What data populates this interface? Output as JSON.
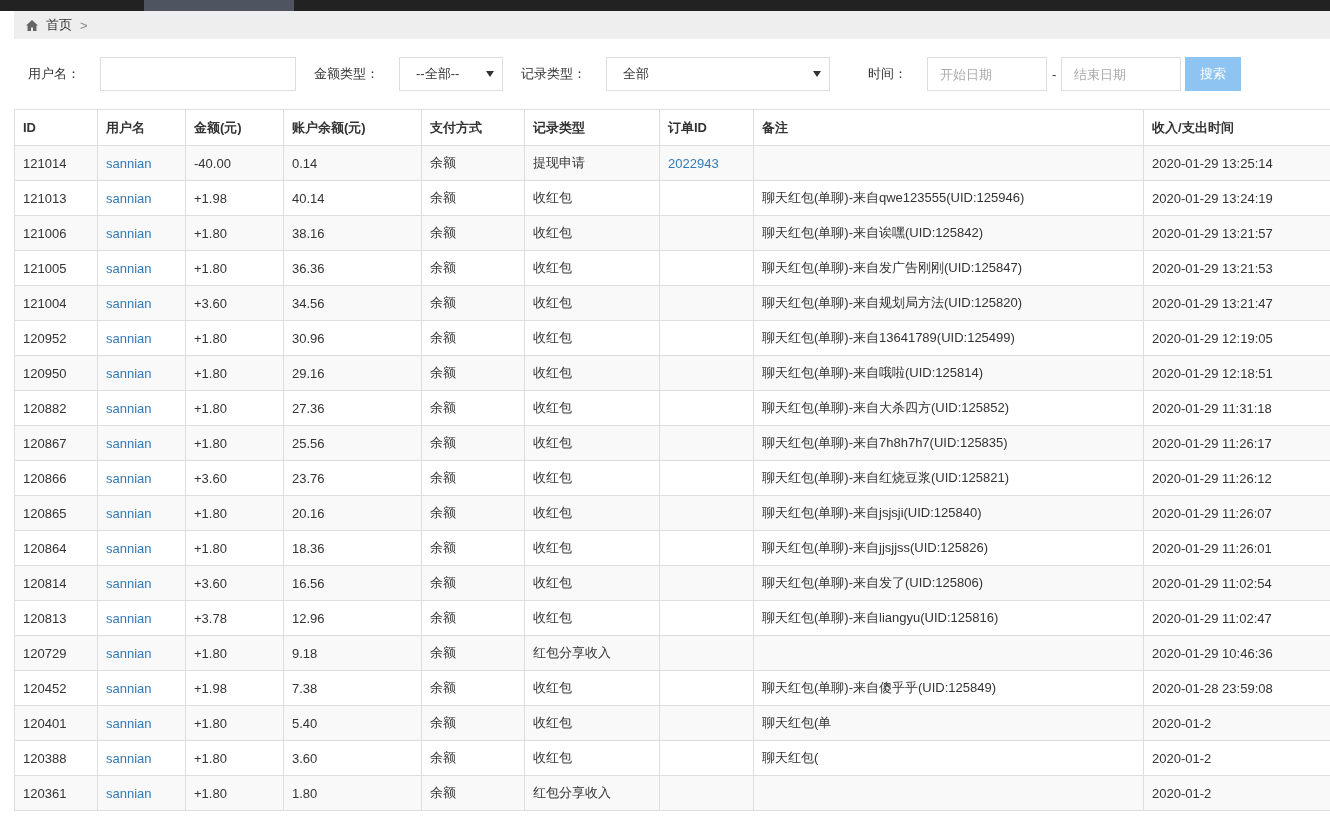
{
  "breadcrumb": {
    "home": "首页",
    "separator": ">"
  },
  "filters": {
    "username_label": "用户名：",
    "amount_type_label": "金额类型：",
    "amount_type_value": "--全部--",
    "record_type_label": "记录类型：",
    "record_type_value": "全部",
    "time_label": "时间：",
    "start_placeholder": "开始日期",
    "range_separator": "-",
    "end_placeholder": "结束日期",
    "search_button": "搜索"
  },
  "table": {
    "columns": [
      "ID",
      "用户名",
      "金额(元)",
      "账户余额(元)",
      "支付方式",
      "记录类型",
      "订单ID",
      "备注",
      "收入/支出时间"
    ],
    "rows": [
      [
        "121014",
        "sannian",
        "-40.00",
        "0.14",
        "余额",
        "提现申请",
        "2022943",
        "",
        "2020-01-29 13:25:14"
      ],
      [
        "121013",
        "sannian",
        "+1.98",
        "40.14",
        "余额",
        "收红包",
        "",
        "聊天红包(单聊)-来自qwe123555(UID:125946)",
        "2020-01-29 13:24:19"
      ],
      [
        "121006",
        "sannian",
        "+1.80",
        "38.16",
        "余额",
        "收红包",
        "",
        "聊天红包(单聊)-来自诶嘿(UID:125842)",
        "2020-01-29 13:21:57"
      ],
      [
        "121005",
        "sannian",
        "+1.80",
        "36.36",
        "余额",
        "收红包",
        "",
        "聊天红包(单聊)-来自发广告刚刚(UID:125847)",
        "2020-01-29 13:21:53"
      ],
      [
        "121004",
        "sannian",
        "+3.60",
        "34.56",
        "余额",
        "收红包",
        "",
        "聊天红包(单聊)-来自规划局方法(UID:125820)",
        "2020-01-29 13:21:47"
      ],
      [
        "120952",
        "sannian",
        "+1.80",
        "30.96",
        "余额",
        "收红包",
        "",
        "聊天红包(单聊)-来自13641789(UID:125499)",
        "2020-01-29 12:19:05"
      ],
      [
        "120950",
        "sannian",
        "+1.80",
        "29.16",
        "余额",
        "收红包",
        "",
        "聊天红包(单聊)-来自哦啦(UID:125814)",
        "2020-01-29 12:18:51"
      ],
      [
        "120882",
        "sannian",
        "+1.80",
        "27.36",
        "余额",
        "收红包",
        "",
        "聊天红包(单聊)-来自大杀四方(UID:125852)",
        "2020-01-29 11:31:18"
      ],
      [
        "120867",
        "sannian",
        "+1.80",
        "25.56",
        "余额",
        "收红包",
        "",
        "聊天红包(单聊)-来自7h8h7h7(UID:125835)",
        "2020-01-29 11:26:17"
      ],
      [
        "120866",
        "sannian",
        "+3.60",
        "23.76",
        "余额",
        "收红包",
        "",
        "聊天红包(单聊)-来自红烧豆浆(UID:125821)",
        "2020-01-29 11:26:12"
      ],
      [
        "120865",
        "sannian",
        "+1.80",
        "20.16",
        "余额",
        "收红包",
        "",
        "聊天红包(单聊)-来自jsjsji(UID:125840)",
        "2020-01-29 11:26:07"
      ],
      [
        "120864",
        "sannian",
        "+1.80",
        "18.36",
        "余额",
        "收红包",
        "",
        "聊天红包(单聊)-来自jjsjjss(UID:125826)",
        "2020-01-29 11:26:01"
      ],
      [
        "120814",
        "sannian",
        "+3.60",
        "16.56",
        "余额",
        "收红包",
        "",
        "聊天红包(单聊)-来自发了(UID:125806)",
        "2020-01-29 11:02:54"
      ],
      [
        "120813",
        "sannian",
        "+3.78",
        "12.96",
        "余额",
        "收红包",
        "",
        "聊天红包(单聊)-来自liangyu(UID:125816)",
        "2020-01-29 11:02:47"
      ],
      [
        "120729",
        "sannian",
        "+1.80",
        "9.18",
        "余额",
        "红包分享收入",
        "",
        "",
        "2020-01-29 10:46:36"
      ],
      [
        "120452",
        "sannian",
        "+1.98",
        "7.38",
        "余额",
        "收红包",
        "",
        "聊天红包(单聊)-来自傻乎乎(UID:125849)",
        "2020-01-28 23:59:08"
      ],
      [
        "120401",
        "sannian",
        "+1.80",
        "5.40",
        "余额",
        "收红包",
        "",
        "聊天红包(单",
        "2020-01-2"
      ],
      [
        "120388",
        "sannian",
        "+1.80",
        "3.60",
        "余额",
        "收红包",
        "",
        "聊天红包(",
        "2020-01-2"
      ],
      [
        "120361",
        "sannian",
        "+1.80",
        "1.80",
        "余额",
        "红包分享收入",
        "",
        "",
        "2020-01-2"
      ]
    ]
  }
}
